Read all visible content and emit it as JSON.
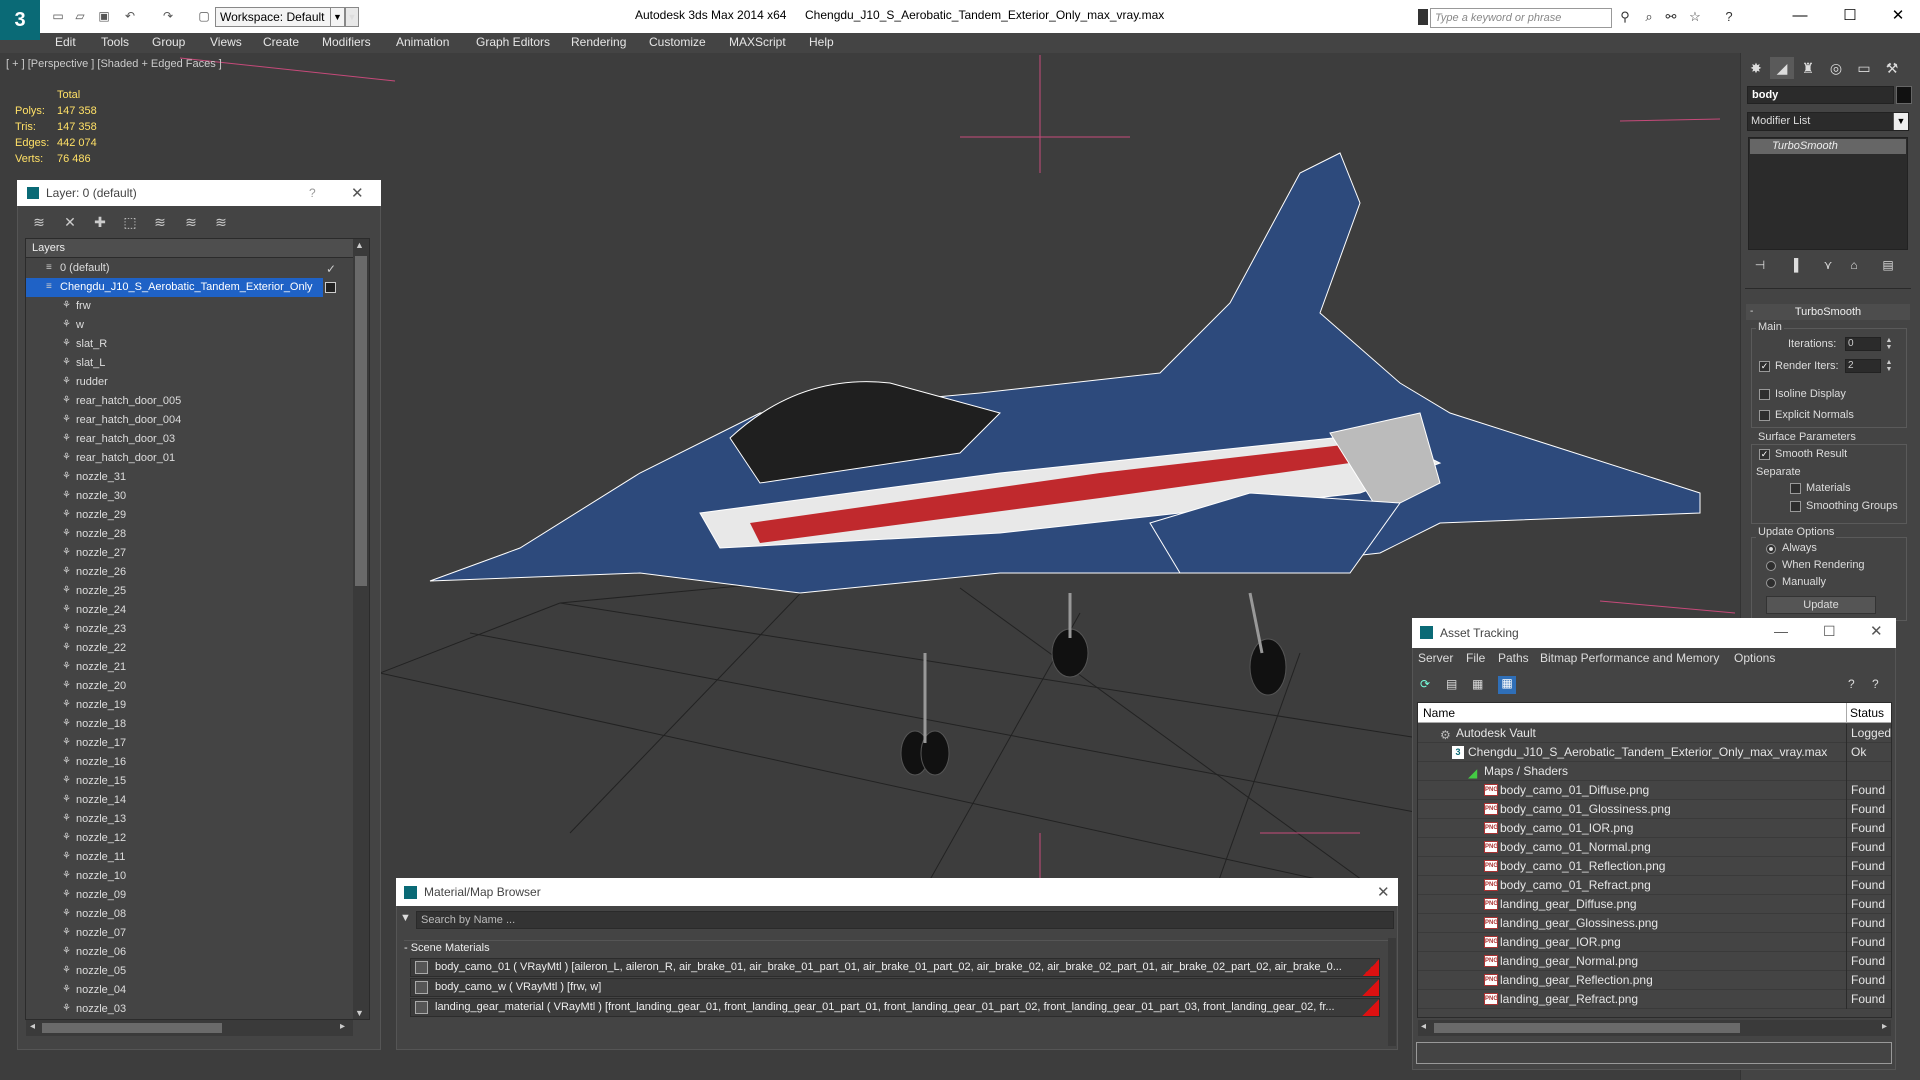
{
  "titlebar": {
    "workspace": "Workspace: Default",
    "app_title": "Autodesk 3ds Max  2014 x64",
    "file_title": "Chengdu_J10_S_Aerobatic_Tandem_Exterior_Only_max_vray.max",
    "search_placeholder": "Type a keyword or phrase"
  },
  "menubar": {
    "items": [
      "Edit",
      "Tools",
      "Group",
      "Views",
      "Create",
      "Modifiers",
      "Animation",
      "Graph Editors",
      "Rendering",
      "Customize",
      "MAXScript",
      "Help"
    ]
  },
  "viewport": {
    "label": "[ + ] [Perspective ] [Shaded + Edged Faces ]",
    "stats": {
      "total_label": "Total",
      "rows": [
        {
          "label": "Polys:",
          "value": "147 358"
        },
        {
          "label": "Tris:",
          "value": "147 358"
        },
        {
          "label": "Edges:",
          "value": "442 074"
        },
        {
          "label": "Verts:",
          "value": "76 486"
        }
      ]
    }
  },
  "layer_panel": {
    "title": "Layer: 0 (default)",
    "help": "?",
    "column": "Layers",
    "rows": [
      "0 (default)",
      "Chengdu_J10_S_Aerobatic_Tandem_Exterior_Only",
      "frw",
      "w",
      "slat_R",
      "slat_L",
      "rudder",
      "rear_hatch_door_005",
      "rear_hatch_door_004",
      "rear_hatch_door_03",
      "rear_hatch_door_01",
      "nozzle_31",
      "nozzle_30",
      "nozzle_29",
      "nozzle_28",
      "nozzle_27",
      "nozzle_26",
      "nozzle_25",
      "nozzle_24",
      "nozzle_23",
      "nozzle_22",
      "nozzle_21",
      "nozzle_20",
      "nozzle_19",
      "nozzle_18",
      "nozzle_17",
      "nozzle_16",
      "nozzle_15",
      "nozzle_14",
      "nozzle_13",
      "nozzle_12",
      "nozzle_11",
      "nozzle_10",
      "nozzle_09",
      "nozzle_08",
      "nozzle_07",
      "nozzle_06",
      "nozzle_05",
      "nozzle_04",
      "nozzle_03"
    ]
  },
  "command_panel": {
    "object_name": "body",
    "modifier_list": "Modifier List",
    "stack_item": "TurboSmooth",
    "rollout_title": "TurboSmooth",
    "main_label": "Main",
    "iterations_label": "Iterations:",
    "iterations_value": "0",
    "render_iters_label": "Render Iters:",
    "render_iters_value": "2",
    "isoline": "Isoline Display",
    "explicit": "Explicit Normals",
    "surface_label": "Surface Parameters",
    "smooth_result": "Smooth Result",
    "separate_label": "Separate",
    "materials": "Materials",
    "smoothing_groups": "Smoothing Groups",
    "update_label": "Update Options",
    "always": "Always",
    "when_rendering": "When Rendering",
    "manually": "Manually",
    "update_button": "Update"
  },
  "material_browser": {
    "title": "Material/Map Browser",
    "search_placeholder": "Search by Name ...",
    "section": "- Scene Materials",
    "rows": [
      "body_camo_01  ( VRayMtl )  [aileron_L, aileron_R, air_brake_01, air_brake_01_part_01, air_brake_01_part_02, air_brake_02, air_brake_02_part_01, air_brake_02_part_02, air_brake_0...",
      "body_camo_w  ( VRayMtl )  [frw, w]",
      "landing_gear_material  ( VRayMtl )  [front_landing_gear_01, front_landing_gear_01_part_01, front_landing_gear_01_part_02, front_landing_gear_01_part_03, front_landing_gear_02, fr..."
    ]
  },
  "asset_tracking": {
    "title": "Asset Tracking",
    "menu": [
      "Server",
      "File",
      "Paths",
      "Bitmap Performance and Memory",
      "Options"
    ],
    "col_name": "Name",
    "col_status": "Status",
    "rows": [
      {
        "name": "Autodesk Vault",
        "status": "Logged",
        "level": 1
      },
      {
        "name": "Chengdu_J10_S_Aerobatic_Tandem_Exterior_Only_max_vray.max",
        "status": "Ok",
        "level": 2
      },
      {
        "name": "Maps / Shaders",
        "status": "",
        "level": 3
      },
      {
        "name": "body_camo_01_Diffuse.png",
        "status": "Found",
        "level": 4
      },
      {
        "name": "body_camo_01_Glossiness.png",
        "status": "Found",
        "level": 4
      },
      {
        "name": "body_camo_01_IOR.png",
        "status": "Found",
        "level": 4
      },
      {
        "name": "body_camo_01_Normal.png",
        "status": "Found",
        "level": 4
      },
      {
        "name": "body_camo_01_Reflection.png",
        "status": "Found",
        "level": 4
      },
      {
        "name": "body_camo_01_Refract.png",
        "status": "Found",
        "level": 4
      },
      {
        "name": "landing_gear_Diffuse.png",
        "status": "Found",
        "level": 4
      },
      {
        "name": "landing_gear_Glossiness.png",
        "status": "Found",
        "level": 4
      },
      {
        "name": "landing_gear_IOR.png",
        "status": "Found",
        "level": 4
      },
      {
        "name": "landing_gear_Normal.png",
        "status": "Found",
        "level": 4
      },
      {
        "name": "landing_gear_Reflection.png",
        "status": "Found",
        "level": 4
      },
      {
        "name": "landing_gear_Refract.png",
        "status": "Found",
        "level": 4
      }
    ]
  }
}
